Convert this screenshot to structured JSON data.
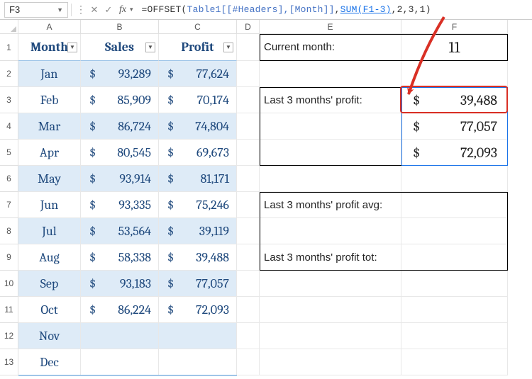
{
  "namebox": "F3",
  "formula": {
    "prefix": "=OFFSET",
    "open": "(",
    "ref": "Table1[[#Headers],[Month]]",
    "comma1": ",",
    "arg_highlight": "SUM(F1-3)",
    "rest": ",2,3,1)"
  },
  "columns": [
    "A",
    "B",
    "C",
    "D",
    "E",
    "F"
  ],
  "rowCount": 13,
  "table": {
    "headers": [
      "Month",
      "Sales",
      "Profit"
    ],
    "rows": [
      {
        "month": "Jan",
        "sales": "93,289",
        "profit": "77,624"
      },
      {
        "month": "Feb",
        "sales": "85,909",
        "profit": "70,174"
      },
      {
        "month": "Mar",
        "sales": "86,724",
        "profit": "74,804"
      },
      {
        "month": "Apr",
        "sales": "80,545",
        "profit": "69,673"
      },
      {
        "month": "May",
        "sales": "93,914",
        "profit": "81,171"
      },
      {
        "month": "Jun",
        "sales": "93,335",
        "profit": "75,246"
      },
      {
        "month": "Jul",
        "sales": "53,564",
        "profit": "39,119"
      },
      {
        "month": "Aug",
        "sales": "58,338",
        "profit": "39,488"
      },
      {
        "month": "Sep",
        "sales": "93,183",
        "profit": "77,057"
      },
      {
        "month": "Oct",
        "sales": "86,224",
        "profit": "72,093"
      },
      {
        "month": "Nov",
        "sales": "",
        "profit": ""
      },
      {
        "month": "Dec",
        "sales": "",
        "profit": ""
      }
    ]
  },
  "right": {
    "current_month_label": "Current month:",
    "current_month_value": "11",
    "last3_label": "Last 3 months' profit:",
    "last3_values": [
      "39,488",
      "77,057",
      "72,093"
    ],
    "avg_label": "Last 3 months' profit avg:",
    "tot_label": "Last 3 months' profit tot:"
  },
  "currency": "$"
}
